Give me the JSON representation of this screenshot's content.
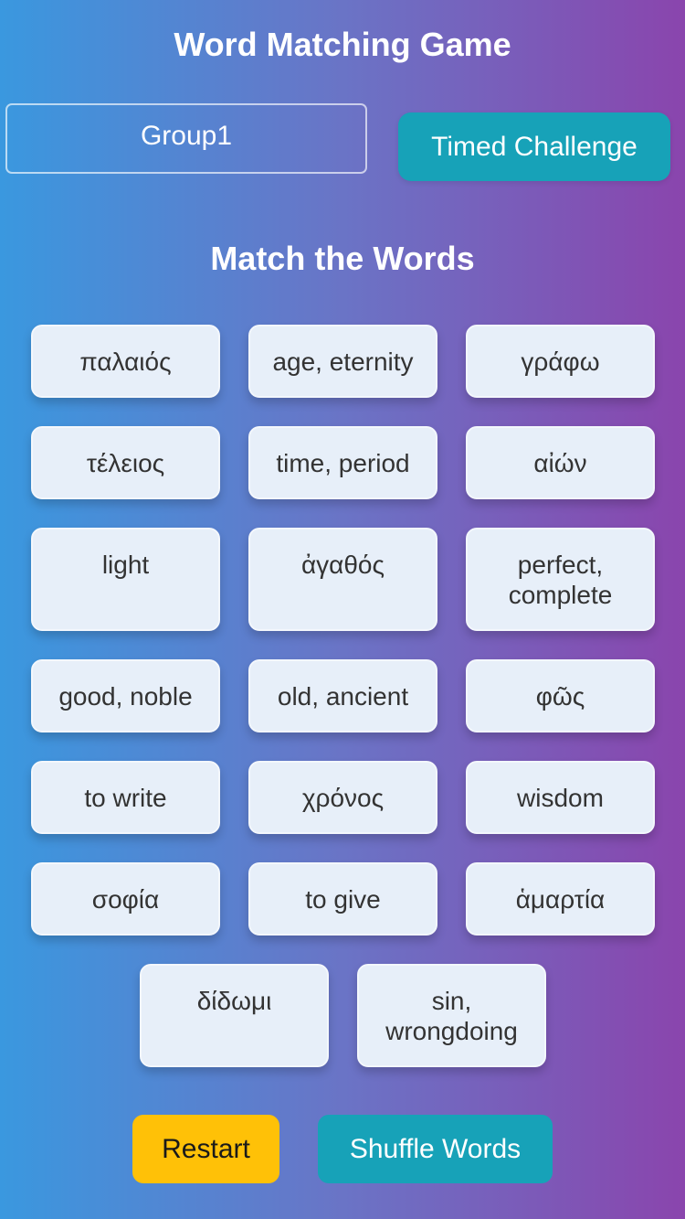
{
  "header": {
    "title": "Word Matching Game",
    "group_select_value": "Group1",
    "timed_challenge_label": "Timed Challenge"
  },
  "board": {
    "subtitle": "Match the Words",
    "cards": [
      "παλαιός",
      "age, eternity",
      "γράφω",
      "τέλειος",
      "time, period",
      "αἰών",
      "light",
      "ἀγαθός",
      "perfect, complete",
      "good, noble",
      "old, ancient",
      "φῶς",
      "to write",
      "χρόνος",
      "wisdom",
      "σοφία",
      "to give",
      "ἁμαρτία",
      "δίδωμι",
      "sin, wrongdoing"
    ]
  },
  "controls": {
    "restart_label": "Restart",
    "shuffle_label": "Shuffle Words"
  },
  "colors": {
    "gradient_start": "#3a98df",
    "gradient_end": "#8a45ad",
    "teal_button": "#17a2b8",
    "restart_button": "#ffc107",
    "card_background": "#e7eff9"
  }
}
